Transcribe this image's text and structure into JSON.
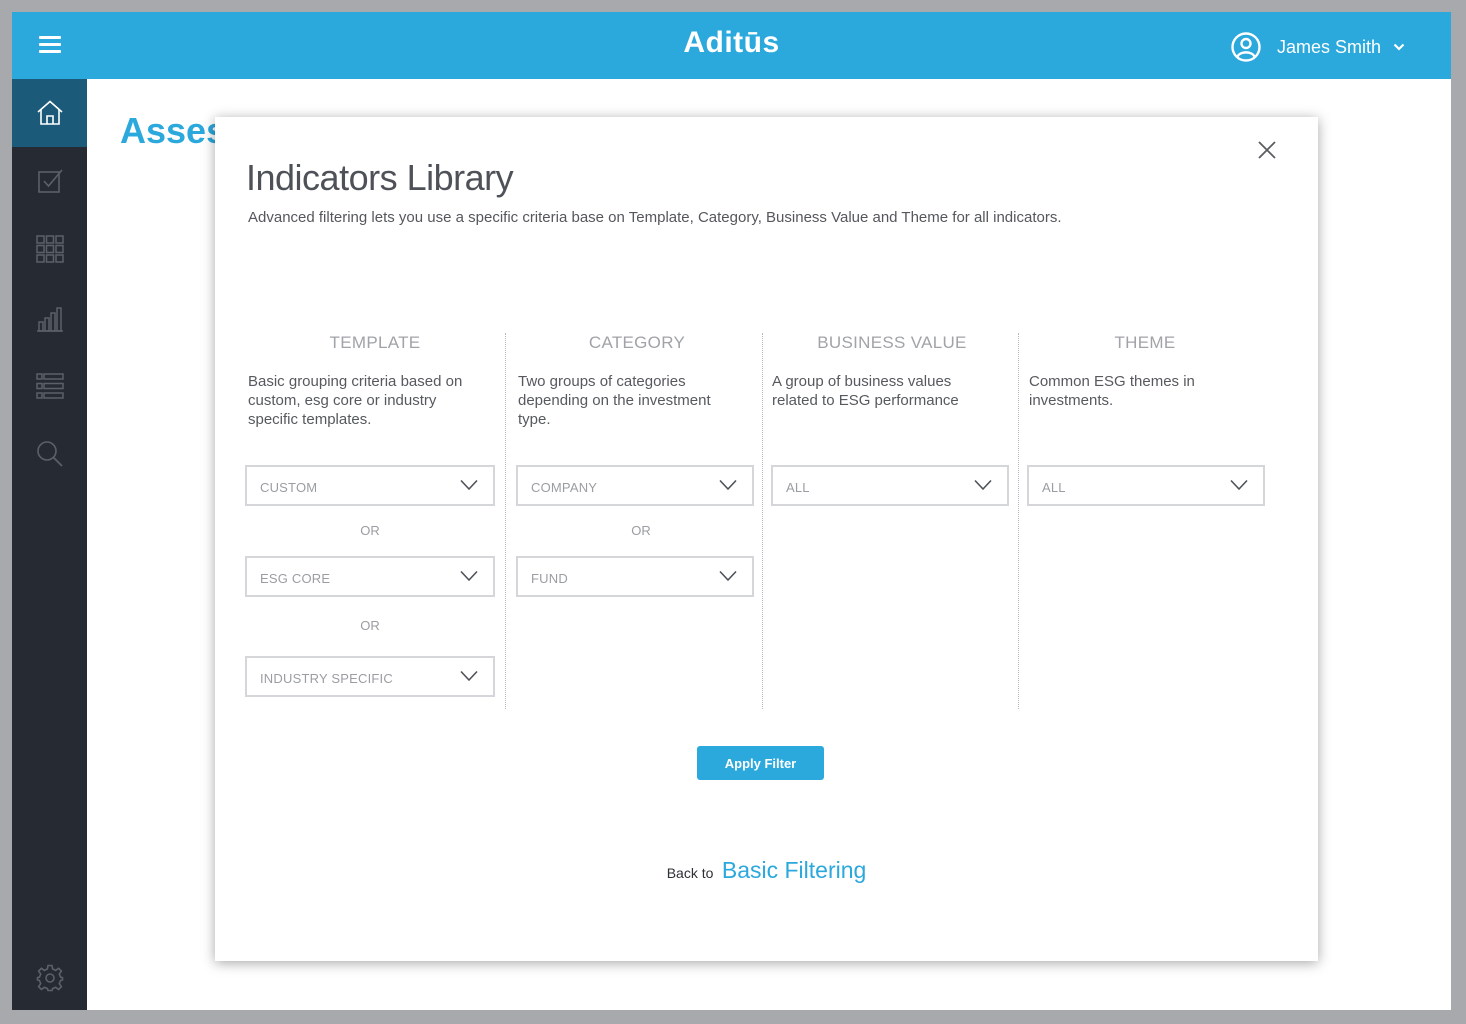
{
  "header": {
    "brand": "Aditūs",
    "user_name": "James Smith"
  },
  "sidebar": {
    "items": [
      {
        "icon": "home-icon",
        "active": true
      },
      {
        "icon": "checkbox-icon",
        "active": false
      },
      {
        "icon": "grid-icon",
        "active": false
      },
      {
        "icon": "bar-chart-icon",
        "active": false
      },
      {
        "icon": "list-icon",
        "active": false
      },
      {
        "icon": "search-icon",
        "active": false
      },
      {
        "icon": "gear-icon",
        "active": false
      }
    ]
  },
  "page": {
    "title": "Asses"
  },
  "modal": {
    "title": "Indicators Library",
    "subtitle": "Advanced filtering lets you use a specific criteria base on Template, Category, Business Value and Theme for all indicators.",
    "or_label": "OR",
    "columns": {
      "template": {
        "heading": "TEMPLATE",
        "description": "Basic grouping criteria based on custom, esg core or industry specific templates.",
        "selects": [
          "CUSTOM",
          "ESG CORE",
          "INDUSTRY SPECIFIC"
        ]
      },
      "category": {
        "heading": "CATEGORY",
        "description": "Two groups of categories depending on the investment type.",
        "selects": [
          "COMPANY",
          "FUND"
        ]
      },
      "business_value": {
        "heading": "BUSINESS VALUE",
        "description": "A group of business values related to ESG performance",
        "selects": [
          "ALL"
        ]
      },
      "theme": {
        "heading": "THEME",
        "description": "Common ESG themes in investments.",
        "selects": [
          "ALL"
        ]
      }
    },
    "apply_label": "Apply Filter",
    "back_prefix": "Back to",
    "back_link": "Basic Filtering"
  },
  "colors": {
    "accent": "#2ba8dc",
    "sidebar_bg": "#262a33",
    "sidebar_active": "#1b5a78",
    "frame": "#a7a9ac"
  }
}
